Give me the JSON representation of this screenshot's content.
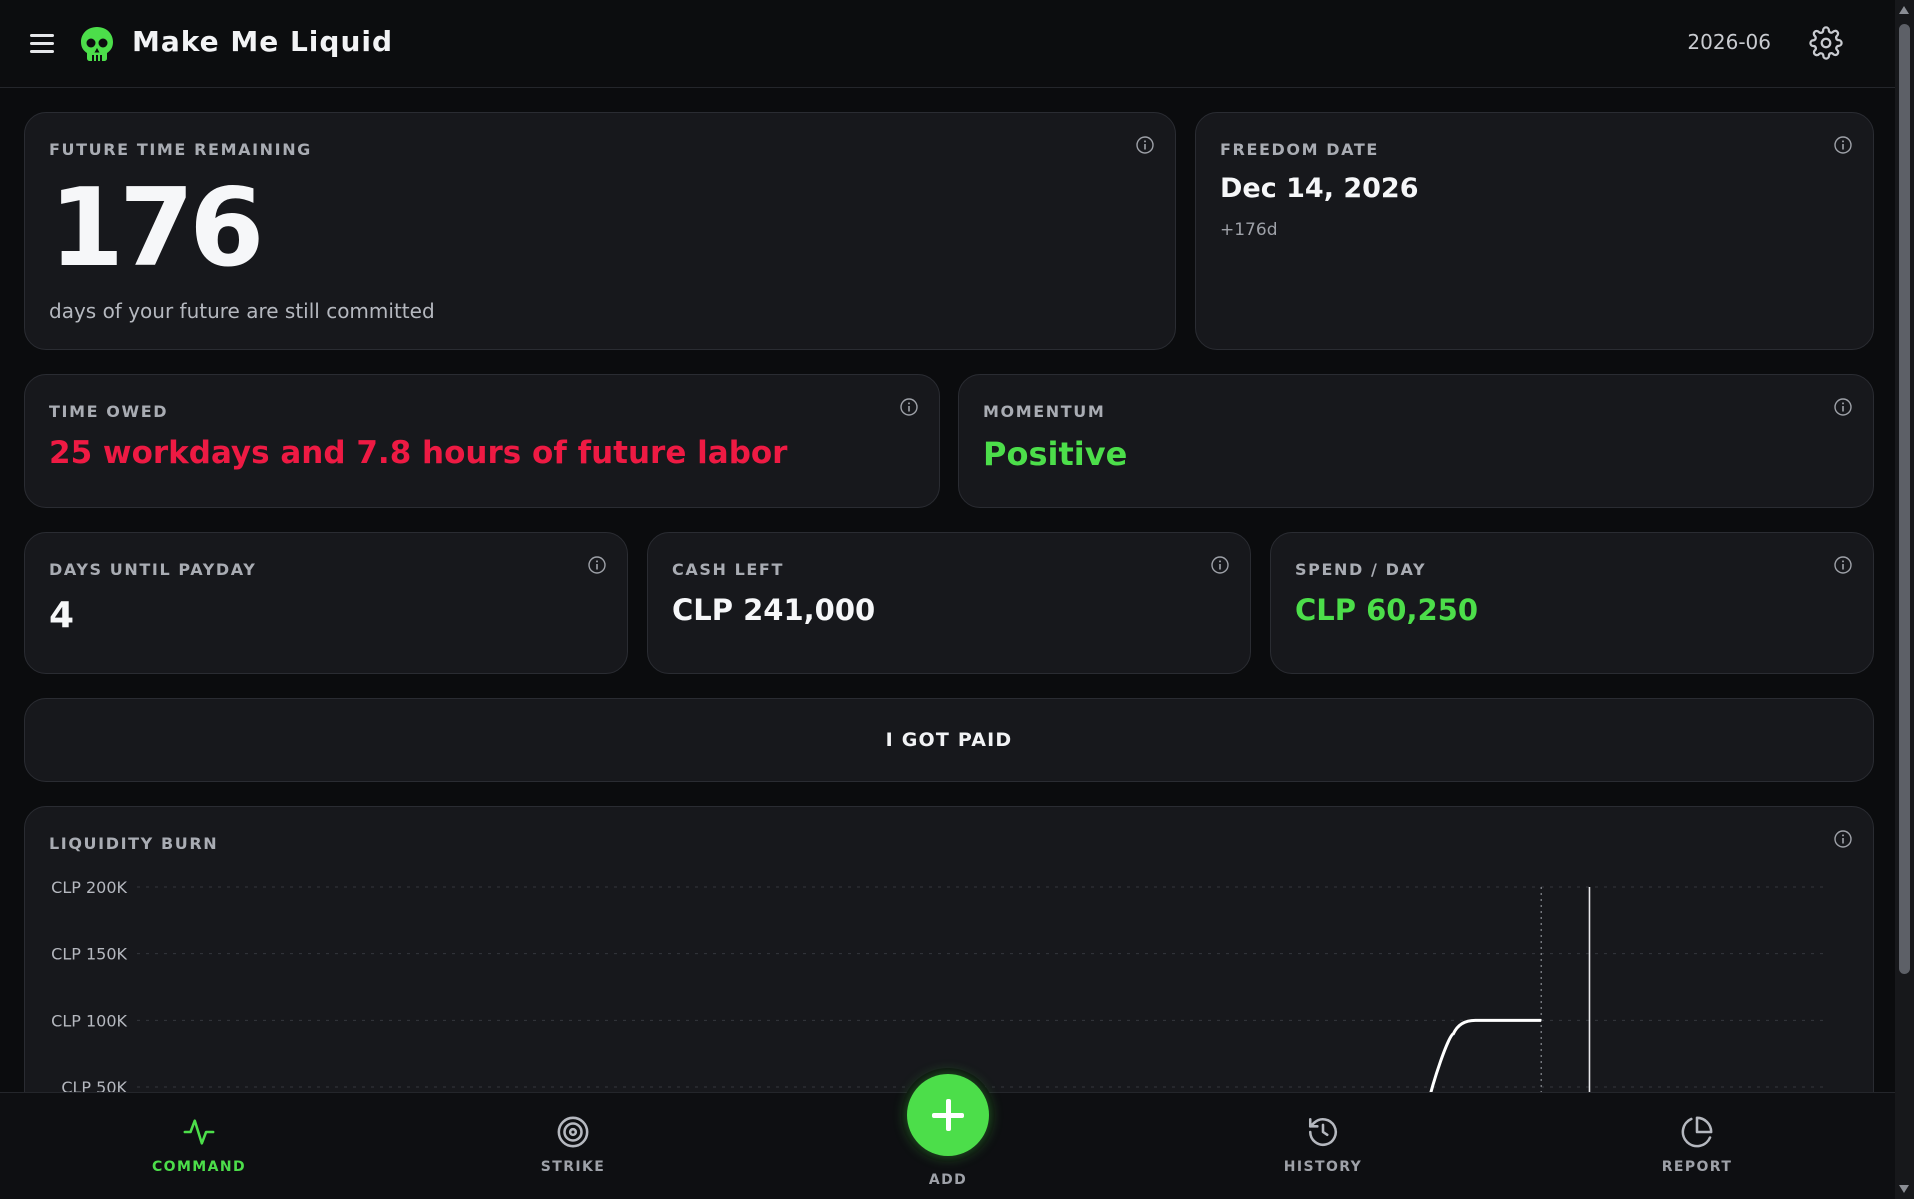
{
  "header": {
    "title": "Make Me Liquid",
    "period": "2026-06",
    "menu_icon": "hamburger-menu-icon",
    "logo_icon": "skull-icon",
    "settings_icon": "gear-icon"
  },
  "cards": {
    "future_time": {
      "label": "FUTURE TIME REMAINING",
      "value": "176",
      "caption": "days of your future are still committed"
    },
    "freedom_date": {
      "label": "FREEDOM DATE",
      "value": "Dec 14, 2026",
      "delta": "+176d"
    },
    "time_owed": {
      "label": "TIME OWED",
      "value": "25 workdays and 7.8 hours of future labor"
    },
    "momentum": {
      "label": "MOMENTUM",
      "value": "Positive"
    },
    "days_until_payday": {
      "label": "DAYS UNTIL PAYDAY",
      "value": "4"
    },
    "cash_left": {
      "label": "CASH LEFT",
      "value": "CLP 241,000"
    },
    "spend_per_day": {
      "label": "SPEND / DAY",
      "value": "CLP 60,250"
    }
  },
  "actions": {
    "got_paid_label": "I GOT PAID"
  },
  "chart": {
    "label": "LIQUIDITY BURN"
  },
  "chart_data": {
    "type": "line",
    "title": "LIQUIDITY BURN",
    "ytick_labels": [
      "CLP 200K",
      "CLP 150K",
      "CLP 100K",
      "CLP 50K"
    ],
    "yticks": [
      200000,
      150000,
      100000,
      50000
    ],
    "ylim": [
      0,
      210000
    ],
    "grid": true,
    "series": [
      {
        "color": "#ffffff",
        "points": [
          [
            0.88,
            25000
          ],
          [
            0.9,
            90000
          ],
          [
            0.915,
            100000
          ],
          [
            0.96,
            100000
          ]
        ]
      }
    ],
    "markers": [
      {
        "style": "dotted",
        "x": 0.96
      },
      {
        "style": "solid",
        "x": 0.993
      }
    ]
  },
  "nav": {
    "items": [
      {
        "label": "COMMAND",
        "icon": "activity-pulse-icon",
        "active": true
      },
      {
        "label": "STRIKE",
        "icon": "target-icon",
        "active": false
      },
      {
        "label": "ADD",
        "icon": "plus-icon",
        "active": false
      },
      {
        "label": "HISTORY",
        "icon": "history-clock-icon",
        "active": false
      },
      {
        "label": "REPORT",
        "icon": "pie-chart-icon",
        "active": false
      }
    ]
  },
  "colors": {
    "accent_green": "#4cde4a",
    "danger_red": "#ee1a43",
    "card_bg": "#17181c",
    "page_bg": "#0b0c0e"
  }
}
